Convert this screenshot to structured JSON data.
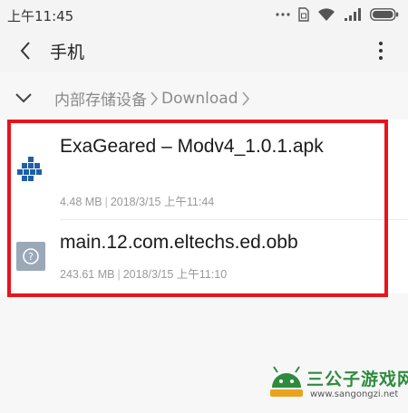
{
  "status_bar": {
    "time": "上午11:45",
    "icons": [
      "more-dots-icon",
      "sim-icon",
      "wifi-icon",
      "signal-icon",
      "battery-icon"
    ]
  },
  "header": {
    "title": "手机"
  },
  "breadcrumb": {
    "items": [
      "内部存储设备",
      "Download"
    ]
  },
  "files": [
    {
      "name": "ExaGeared – Modv4_1.0.1.apk",
      "size": "4.48 MB",
      "datetime": "2018/3/15 上午11:44",
      "icon": "apk-app-icon",
      "icon_color": "#1f5fa8"
    },
    {
      "name": "main.12.com.eltechs.ed.obb",
      "size": "243.61 MB",
      "datetime": "2018/3/15 上午11:10",
      "icon": "unknown-file-icon",
      "icon_color": "#9aa8b8"
    }
  ],
  "highlight_color": "#e8141b",
  "watermark": {
    "main": "三公子游戏网",
    "url": "www.sangongzi.net"
  }
}
